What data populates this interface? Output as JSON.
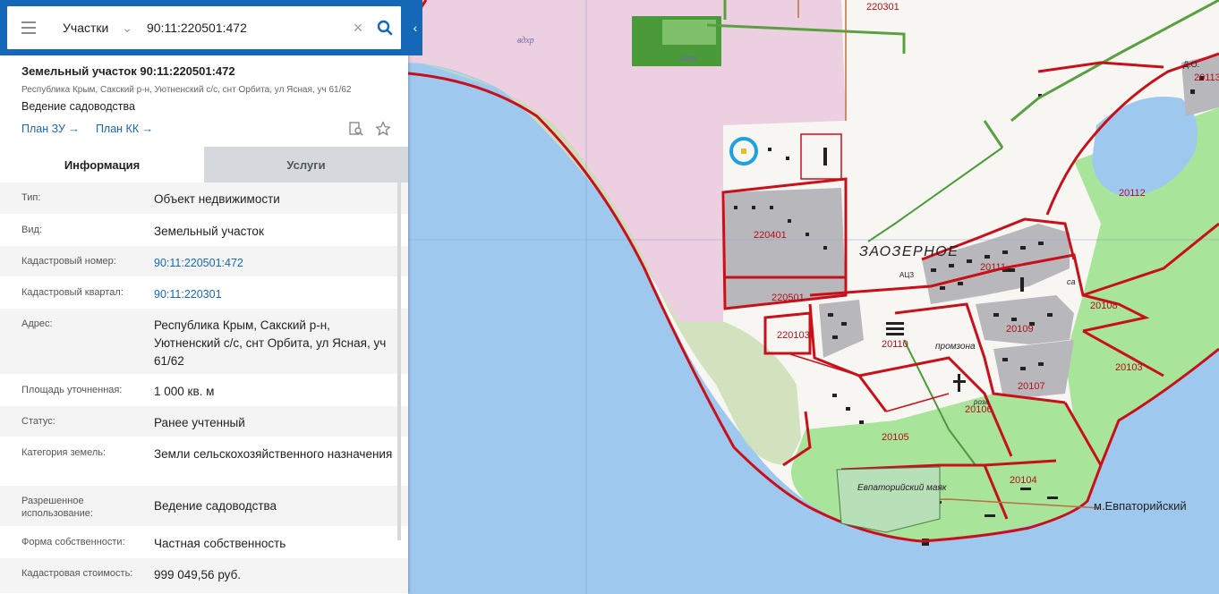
{
  "search": {
    "layer": "Участки",
    "query": "90:11:220501:472"
  },
  "parcel": {
    "title": "Земельный участок 90:11:220501:472",
    "address": "Республика Крым, Сакский р-н, Уютненский с/с, снт Орбита, ул Ясная, уч 61/62",
    "use": "Ведение садоводства",
    "plan_zu": "План ЗУ →",
    "plan_kk": "План КК →"
  },
  "tabs": [
    "Информация",
    "Услуги"
  ],
  "info": [
    {
      "label": "Тип:",
      "value": "Объект недвижимости"
    },
    {
      "label": "Вид:",
      "value": "Земельный участок"
    },
    {
      "label": "Кадастровый номер:",
      "value": "90:11:220501:472"
    },
    {
      "label": "Кадастровый квартал:",
      "value": "90:11:220301"
    },
    {
      "label": "Адрес:",
      "value": "Республика Крым, Сакский р-н, Уютненский с/с, снт Орбита, ул Ясная, уч 61/62"
    },
    {
      "label": "Площадь уточненная:",
      "value": "1 000 кв. м"
    },
    {
      "label": "Статус:",
      "value": "Ранее учтенный"
    },
    {
      "label": "Категория земель:",
      "value": "Земли сельскохозяйственного назначения"
    },
    {
      "label": "Разрешенное использование:",
      "value": "Ведение садоводства"
    },
    {
      "label": "Форма собственности:",
      "value": "Частная собственность"
    },
    {
      "label": "Кадастровая стоимость:",
      "value": "999 049,56 руб."
    }
  ],
  "map": {
    "labels": {
      "q220301": "220301",
      "q220401": "220401",
      "q220501": "220501",
      "q220103": "220103",
      "town": "ЗАОЗЕРНОЕ",
      "q20111": "20111",
      "q20113": "20113",
      "q20112": "20112",
      "q20108": "20108",
      "q20109": "20109",
      "q20110": "20110",
      "q20107": "20107",
      "q20106": "20106",
      "q20105": "20105",
      "q20103": "20103",
      "q20104": "20104",
      "cape": "м.Евпаторийский",
      "lighthouse": "Евпаторийский маяк",
      "industrial": "промзона",
      "reservoir1": "вдхр",
      "reservoir2": "вдхр",
      "do": "Д.О.",
      "ats": "АЦЗ",
      "sa": "са",
      "roza": "роза"
    },
    "colors": {
      "sea": "#9fc8ef",
      "land_pink": "#eccfe0",
      "land_green": "#a8e49a",
      "boundary_red": "#c8101a",
      "highlight_circle": "#1fa0e0"
    }
  }
}
